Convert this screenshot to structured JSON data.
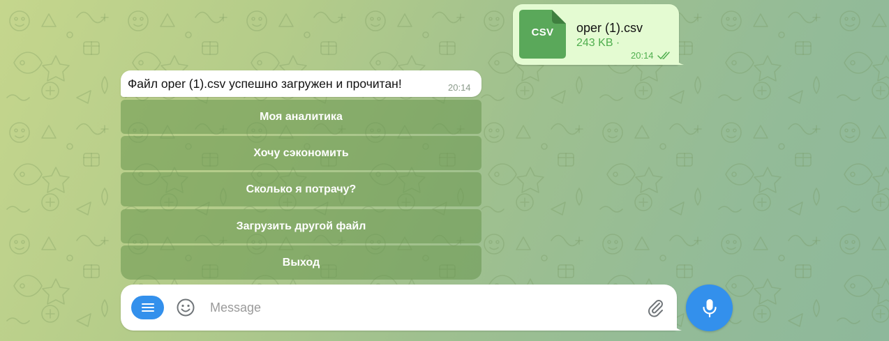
{
  "outgoing_file": {
    "icon_label": "CSV",
    "file_name": "oper (1).csv",
    "file_size": "243 KB ·",
    "time": "20:14",
    "status_icon": "double-check-icon"
  },
  "incoming_message": {
    "text": "Файл oper (1).csv успешно загружен и прочитан!",
    "time": "20:14"
  },
  "inline_keyboard": {
    "buttons": [
      {
        "label": "Моя аналитика"
      },
      {
        "label": "Хочу сэкономить"
      },
      {
        "label": "Сколько я потрачу?"
      },
      {
        "label": "Загрузить другой файл"
      },
      {
        "label": "Выход"
      }
    ]
  },
  "composer": {
    "placeholder": "Message",
    "value": "",
    "menu_icon": "menu-icon",
    "emoji_icon": "smile-icon",
    "attach_icon": "paperclip-icon",
    "send_icon": "microphone-icon"
  },
  "colors": {
    "accent": "#3390ec",
    "outgoing_bubble": "#e4fbd2",
    "file_icon": "#5aa85a",
    "outgoing_meta": "#4fae4e",
    "keyboard_button": "#68964e"
  }
}
